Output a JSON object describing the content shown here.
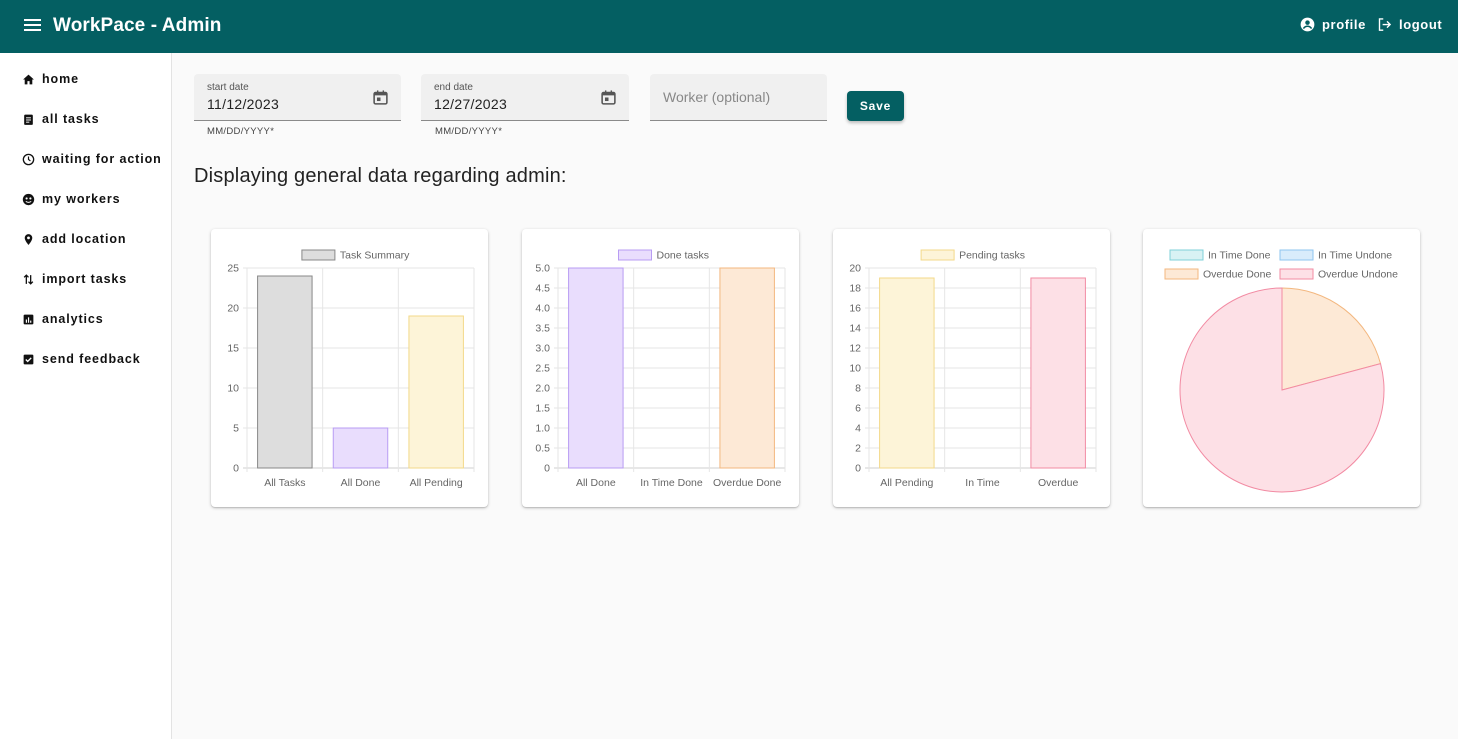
{
  "app": {
    "title": "WorkPace - Admin"
  },
  "header": {
    "profile_label": "profile",
    "logout_label": "logout"
  },
  "sidebar": {
    "items": [
      {
        "label": "home",
        "icon": "home-icon"
      },
      {
        "label": "all tasks",
        "icon": "clipboard-icon"
      },
      {
        "label": "waiting for action",
        "icon": "clock-icon"
      },
      {
        "label": "my workers",
        "icon": "globe-icon"
      },
      {
        "label": "add location",
        "icon": "location-pin-icon"
      },
      {
        "label": "import tasks",
        "icon": "import-arrows-icon"
      },
      {
        "label": "analytics",
        "icon": "analytics-icon"
      },
      {
        "label": "send feedback",
        "icon": "checkbox-icon"
      }
    ]
  },
  "filters": {
    "start_label": "start date",
    "start_value": "11/12/2023",
    "start_helper": "MM/DD/YYYY",
    "end_label": "end date",
    "end_value": "12/27/2023",
    "end_helper": "MM/DD/YYYY",
    "worker_placeholder": "Worker (optional)",
    "worker_value": "",
    "save_label": "Save"
  },
  "main": {
    "heading": "Displaying general data regarding admin:"
  },
  "colors": {
    "brand": "#045f62",
    "background": "#fafafa"
  },
  "chart_data": [
    {
      "type": "bar",
      "categories": [
        "All Tasks",
        "All Done",
        "All Pending"
      ],
      "series": [
        {
          "name": "Task Summary",
          "values": [
            24,
            5,
            19
          ]
        }
      ],
      "ylim": [
        0,
        25
      ],
      "yticks": [
        "0",
        "5",
        "10",
        "15",
        "20",
        "25"
      ],
      "legend": "top",
      "grid": true,
      "colors": [
        {
          "fill": "#dddddd",
          "stroke": "#888888"
        },
        {
          "fill": "#e9ddfd",
          "stroke": "#b89cf3"
        },
        {
          "fill": "#fdf4d8",
          "stroke": "#f3d98a"
        }
      ]
    },
    {
      "type": "bar",
      "categories": [
        "All Done",
        "In Time Done",
        "Overdue Done"
      ],
      "series": [
        {
          "name": "Done tasks",
          "values": [
            5,
            0,
            5
          ]
        }
      ],
      "ylim": [
        0,
        5
      ],
      "yticks": [
        "0",
        "0.5",
        "1.0",
        "1.5",
        "2.0",
        "2.5",
        "3.0",
        "3.5",
        "4.0",
        "4.5",
        "5.0"
      ],
      "legend": "top",
      "grid": true,
      "colors": [
        {
          "fill": "#e9ddfd",
          "stroke": "#b89cf3"
        },
        {
          "fill": "#d8f2f4",
          "stroke": "#7fd0d8"
        },
        {
          "fill": "#fde9d6",
          "stroke": "#f3b77f"
        }
      ]
    },
    {
      "type": "bar",
      "categories": [
        "All Pending",
        "In Time",
        "Overdue"
      ],
      "series": [
        {
          "name": "Pending tasks",
          "values": [
            19,
            0,
            19
          ]
        }
      ],
      "ylim": [
        0,
        20
      ],
      "yticks": [
        "0",
        "2",
        "4",
        "6",
        "8",
        "10",
        "12",
        "14",
        "16",
        "18",
        "20"
      ],
      "legend": "top",
      "grid": true,
      "colors": [
        {
          "fill": "#fdf4d8",
          "stroke": "#f3d98a"
        },
        {
          "fill": "#d9ecfb",
          "stroke": "#8ec5ef"
        },
        {
          "fill": "#fde0e6",
          "stroke": "#f28ba3"
        }
      ]
    },
    {
      "type": "pie",
      "labels": [
        "In Time Done",
        "In Time Undone",
        "Overdue Done",
        "Overdue Undone"
      ],
      "values": [
        0,
        0,
        5,
        19
      ],
      "legend": "top",
      "colors": [
        {
          "fill": "#d8f2f4",
          "stroke": "#7fd0d8"
        },
        {
          "fill": "#d9ecfb",
          "stroke": "#8ec5ef"
        },
        {
          "fill": "#fde9d6",
          "stroke": "#f3b77f"
        },
        {
          "fill": "#fde0e6",
          "stroke": "#f28ba3"
        }
      ]
    }
  ]
}
